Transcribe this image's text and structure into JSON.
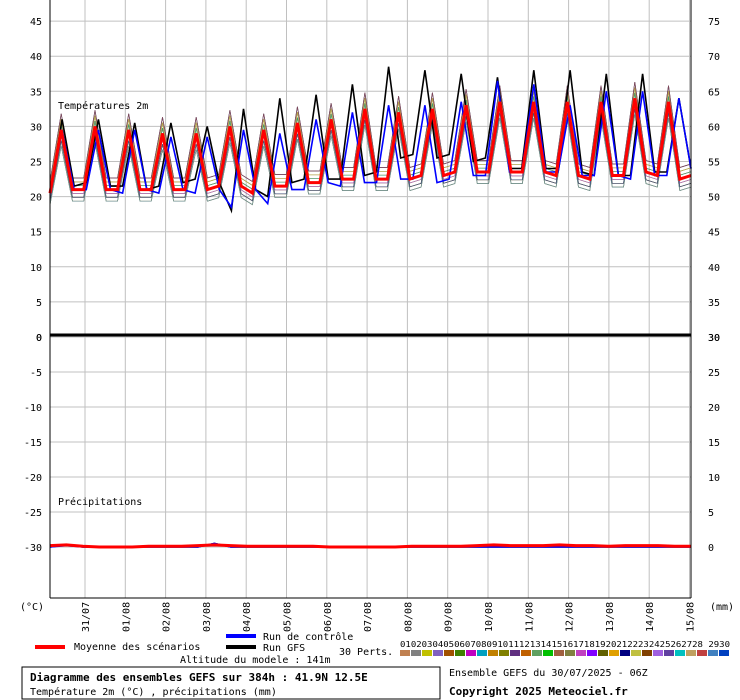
{
  "chart_data": [
    {
      "type": "line",
      "panel": "temperature",
      "annotation": "Températures 2m",
      "y_left_ticks": [
        0,
        5,
        10,
        15,
        20,
        25,
        30,
        35,
        40,
        45
      ],
      "y_right_ticks": [
        30,
        35,
        40,
        45,
        50,
        55,
        60,
        65,
        70,
        75
      ],
      "ylim": [
        0,
        47
      ],
      "x_tick_labels": [
        "31/07",
        "01/08",
        "02/08",
        "03/08",
        "04/08",
        "05/08",
        "06/08",
        "07/08",
        "08/08",
        "09/08",
        "10/08",
        "11/08",
        "12/08",
        "13/08",
        "14/08",
        "15/08"
      ],
      "grid": true,
      "series": [
        {
          "name": "Moyenne des scénarios",
          "color": "#ff0000",
          "values": [
            20.5,
            29.5,
            21,
            21,
            30,
            21,
            21,
            29.5,
            21,
            21,
            29,
            21,
            21,
            29,
            21,
            21.5,
            30,
            21.5,
            20.5,
            29.5,
            21.5,
            21.5,
            30.5,
            22,
            22,
            31,
            22.5,
            22.5,
            32.5,
            22.5,
            22.5,
            32,
            22.5,
            23,
            32.5,
            23,
            23.5,
            33,
            23.5,
            23.5,
            33.5,
            23.5,
            23.5,
            33.5,
            23.5,
            23,
            33.5,
            23,
            22.5,
            33.5,
            23,
            23,
            34,
            23.5,
            23,
            33.5,
            22.5,
            23
          ]
        },
        {
          "name": "Run GFS",
          "color": "#000000",
          "values": [
            20.5,
            31,
            21.5,
            22,
            31,
            21.5,
            21.5,
            30.5,
            21,
            21.5,
            30.5,
            22,
            22.5,
            30,
            22,
            18,
            32.5,
            21,
            20,
            34,
            22,
            22.5,
            34.5,
            22.5,
            22.5,
            36,
            23,
            23.5,
            38.5,
            25.5,
            26,
            38,
            25.5,
            26,
            37.5,
            25,
            25.5,
            37,
            24,
            24,
            38,
            24,
            24,
            38,
            23.5,
            23,
            37.5,
            23,
            23,
            37.5,
            23.5,
            23.5,
            34,
            24
          ]
        },
        {
          "name": "Run de contrôle",
          "color": "#0000ff",
          "values": [
            20.5,
            29.5,
            21,
            21,
            29.5,
            21,
            20.5,
            29.5,
            21,
            20.5,
            28.5,
            21,
            20.5,
            28.5,
            21,
            18.5,
            29.5,
            21,
            19,
            29,
            21,
            21,
            31,
            22,
            21.5,
            32,
            22,
            22,
            33,
            22.5,
            22.5,
            33,
            22,
            22.5,
            33.5,
            23,
            23,
            36.5,
            23.5,
            23.5,
            36,
            23.5,
            23.5,
            33,
            23,
            23,
            35,
            23,
            22.5,
            35,
            23,
            23,
            34,
            24
          ]
        }
      ]
    },
    {
      "type": "line",
      "panel": "precipitation",
      "annotation": "Précipitations",
      "unit_left": "(°C)",
      "unit_right": "(mm)",
      "y_left_ticks": [
        0,
        -5,
        -10,
        -15,
        -20,
        -25,
        -30
      ],
      "y_right_ticks": [
        30,
        25,
        20,
        15,
        10,
        5,
        0
      ],
      "ylim_mm": [
        -5.5,
        30
      ],
      "grid": true,
      "series": [
        {
          "name": "Moyenne des scénarios",
          "color": "#ff0000",
          "values": [
            0.2,
            0.3,
            0.1,
            0,
            0,
            0,
            0.1,
            0.1,
            0.1,
            0.2,
            0.3,
            0.2,
            0.1,
            0.1,
            0.1,
            0.1,
            0.1,
            0,
            0,
            0,
            0,
            0,
            0.1,
            0.1,
            0.1,
            0.1,
            0.2,
            0.3,
            0.2,
            0.2,
            0.2,
            0.3,
            0.2,
            0.2,
            0.1,
            0.2,
            0.2,
            0.2,
            0.1,
            0.1
          ]
        },
        {
          "name": "Run GFS",
          "color": "#000000",
          "values": [
            0,
            0.3,
            0,
            0,
            0,
            0,
            0,
            0,
            0,
            0,
            0.5,
            0,
            0,
            0,
            0,
            0,
            0,
            0,
            0,
            0,
            0,
            0,
            0,
            0,
            0,
            0,
            0,
            0,
            0,
            0,
            0,
            0,
            0,
            0,
            0,
            0,
            0,
            0,
            0,
            0
          ]
        },
        {
          "name": "Run de contrôle",
          "color": "#0000ff",
          "values": [
            0,
            0.2,
            0,
            0,
            0,
            0,
            0,
            0,
            0,
            0,
            0.5,
            0,
            0,
            0,
            0,
            0,
            0,
            0,
            0,
            0,
            0,
            0,
            0,
            0,
            0,
            0,
            0,
            0,
            0,
            0,
            0,
            0,
            0,
            0,
            0,
            0,
            0,
            0,
            0,
            0
          ]
        }
      ]
    }
  ],
  "legend": {
    "mean_label": "Moyenne des scénarios",
    "control_label": "Run de contrôle",
    "gfs_label": "Run GFS",
    "perts_label": "30 Perts.",
    "altitude_label": "Altitude du modele : 141m",
    "pert_numbers": "01020304050607080910111213141516171819202122232425262728 2930",
    "pert_colors": [
      "#c08050",
      "#808080",
      "#c0c000",
      "#8060c0",
      "#a05000",
      "#408000",
      "#c000c0",
      "#00a0c0",
      "#c08000",
      "#808000",
      "#603080",
      "#c06000",
      "#60a060",
      "#00c000",
      "#a06040",
      "#808040",
      "#c040c0",
      "#8000ff",
      "#606000",
      "#e0a000",
      "#000080",
      "#c0c040",
      "#804000",
      "#a060e0",
      "#6040a0",
      "#00c0c0",
      "#c0a060",
      "#c04040",
      "#4080c0",
      "#0040c0"
    ]
  },
  "footer": {
    "diagram_title": "Diagramme des ensembles GEFS sur 384h : 41.9N 12.5E",
    "diagram_subtitle": "Température 2m (°C) , précipitations (mm)",
    "run_info": "Ensemble GEFS du 30/07/2025 - 06Z",
    "copyright": "Copyright 2025 Meteociel.fr"
  },
  "colors": {
    "grid": "#c0c0c0",
    "mean": "#ff0000",
    "gfs": "#000000",
    "control": "#0000ff"
  }
}
